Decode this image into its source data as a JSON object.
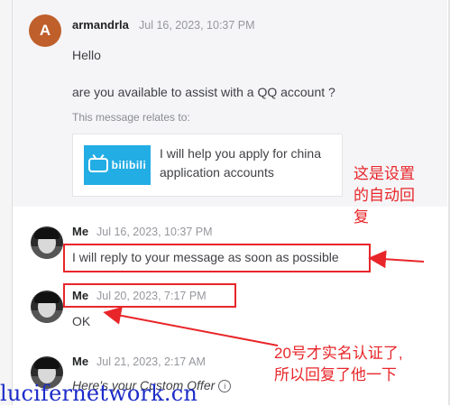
{
  "messages": [
    {
      "avatar_letter": "A",
      "sender": "armandrla",
      "timestamp": "Jul 16, 2023, 10:37 PM",
      "greeting": "Hello",
      "body": "are you available to assist with a QQ account ?",
      "relates_label": "This message relates to:",
      "gig": {
        "brand": "bilibili",
        "title": "I will help you apply for china application accounts"
      }
    },
    {
      "sender": "Me",
      "timestamp": "Jul 16, 2023, 10:37 PM",
      "body": "I will reply to your message as soon as possible"
    },
    {
      "sender": "Me",
      "timestamp": "Jul 20, 2023, 7:17 PM",
      "body": "OK"
    },
    {
      "sender": "Me",
      "timestamp": "Jul 21, 2023, 2:17 AM",
      "body": "Here's your Custom Offer",
      "info_icon": "info-icon"
    }
  ],
  "annotations": {
    "auto_reply_note_line1": "这是设置",
    "auto_reply_note_line2": "的自动回",
    "auto_reply_note_line3": "复",
    "verify_note_line1": "20号才实名认证了,",
    "verify_note_line2": "所以回复了他一下",
    "color": "#e8262a"
  },
  "watermark": "lucifernetwork.cn",
  "colors": {
    "avatar_a": "#bf5f2b",
    "bilibili_blue": "#23ade5",
    "watermark_blue": "#1c2cc8"
  }
}
